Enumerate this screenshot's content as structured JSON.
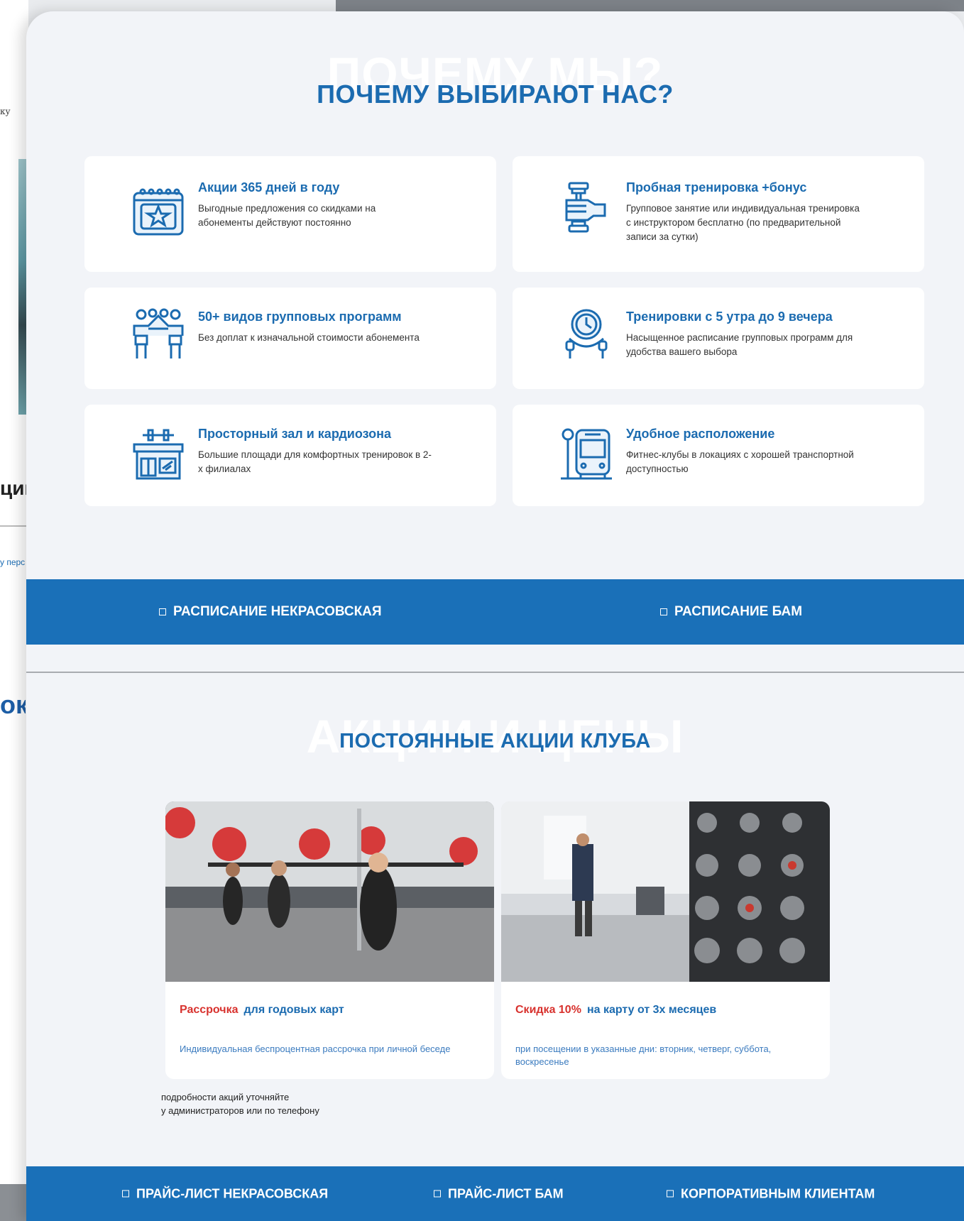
{
  "background": {
    "fragment_1": "ку",
    "fragment_2": "ции",
    "fragment_3": "у перс",
    "fragment_4": "ок"
  },
  "why_section": {
    "ghost_title": "ПОЧЕМУ МЫ?",
    "title": "ПОЧЕМУ ВЫБИРАЮТ НАС?",
    "cards": [
      {
        "icon": "calendar-star-icon",
        "title": "Акции 365 дней в году",
        "text": "Выгодные предложения со скидками на абонементы действуют постоянно"
      },
      {
        "icon": "dumbbell-hand-icon",
        "title": "Пробная тренировка +бонус",
        "text": "Групповое занятие или индивидуальная тренировка с инструктором бесплатно (по предварительной записи за сутки)"
      },
      {
        "icon": "group-people-icon",
        "title": "50+ видов групповых программ",
        "text": "Без доплат к изначальной стоимости абонемента"
      },
      {
        "icon": "stopwatch-rope-icon",
        "title": "Тренировки с 5 утра до 9 вечера",
        "text": "Насыщенное расписание групповых программ для удобства вашего выбора"
      },
      {
        "icon": "gym-building-icon",
        "title": "Просторный зал и кардиозона",
        "text": "Большие площади для комфортных тренировок в 2-х филиалах"
      },
      {
        "icon": "bus-stop-icon",
        "title": "Удобное расположение",
        "text": "Фитнес-клубы в локациях с хорошей транспортной доступностью"
      }
    ]
  },
  "schedule_bar": {
    "left_label": "РАСПИСАНИЕ НЕКРАСОВСКАЯ",
    "right_label": "РАСПИСАНИЕ БАМ"
  },
  "promo_section": {
    "ghost_title": "АКЦИИ И ЦЕНЫ",
    "title": "ПОСТОЯННЫЕ АКЦИИ КЛУБА",
    "cards": [
      {
        "accent": "Рассрочка",
        "title": "для годовых карт",
        "text": "Индивидуальная беспроцентная рассрочка при личной беседе"
      },
      {
        "accent": "Скидка 10%",
        "title": "на карту от 3х месяцев",
        "text": "при посещении в указанные дни: вторник, четверг, суббота, воскресенье"
      }
    ],
    "note_line1": "подробности акций уточняйте",
    "note_line2": "у администраторов или по телефону"
  },
  "price_bar": {
    "item1": "ПРАЙС-ЛИСТ НЕКРАСОВСКАЯ",
    "item2": "ПРАЙС-ЛИСТ БАМ",
    "item3": "КОРПОРАТИВНЫМ КЛИЕНТАМ"
  },
  "colors": {
    "brand_blue": "#1b6bb0",
    "bar_blue": "#1a70b8",
    "accent_red": "#d8322e"
  }
}
